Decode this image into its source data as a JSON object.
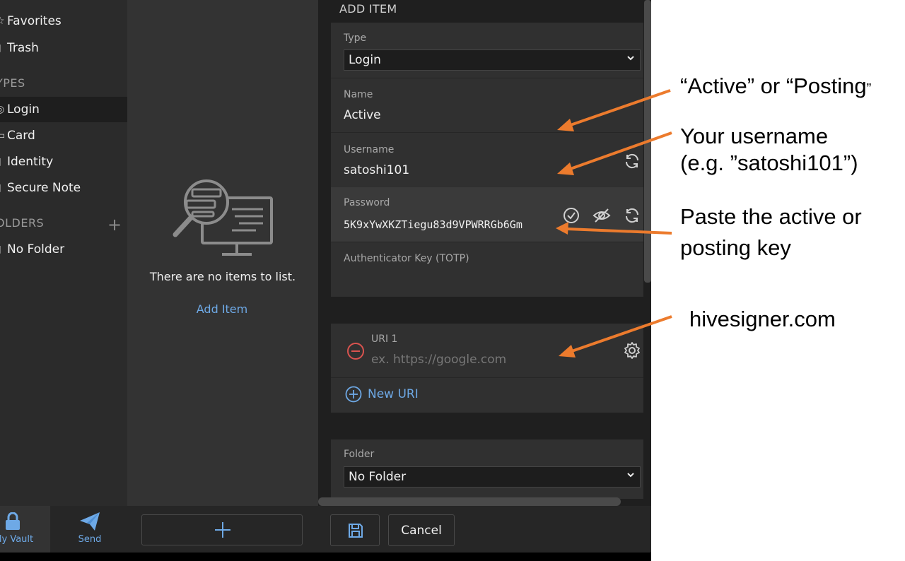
{
  "sidebar": {
    "items": [
      {
        "label": "Favorites"
      },
      {
        "label": "Trash"
      },
      {
        "label": "Login"
      },
      {
        "label": "Card"
      },
      {
        "label": "Identity"
      },
      {
        "label": "Secure Note"
      },
      {
        "label": "No Folder"
      }
    ],
    "types_header": "YPES",
    "folders_header": "OLDERS"
  },
  "list": {
    "empty_text": "There are no items to list.",
    "add_item_link": "Add Item"
  },
  "editor": {
    "title": "ADD ITEM",
    "type_label": "Type",
    "type_value": "Login",
    "name_label": "Name",
    "name_value": "Active",
    "username_label": "Username",
    "username_value": "satoshi101",
    "password_label": "Password",
    "password_value": "5K9xYwXKZTiegu83d9VPWRRGb6Gm",
    "totp_label": "Authenticator Key (TOTP)",
    "uri_label": "URI 1",
    "uri_placeholder": "ex. https://google.com",
    "new_uri_label": "New URI",
    "folder_label": "Folder",
    "folder_value": "No Folder"
  },
  "bottombar": {
    "vault_label": "ly Vault",
    "send_label": "Send",
    "cancel_label": "Cancel"
  },
  "annotations": {
    "name_note": "“Active” or “Posting",
    "name_note_end": "”",
    "username_note_1": "Your username",
    "username_note_2": "(e.g. ”satoshi101”)",
    "password_note_1": "Paste the active or",
    "password_note_2": "posting key",
    "uri_note": "hivesigner.com"
  },
  "colors": {
    "accent": "#6ea9e6",
    "arrow": "#ec7b2d",
    "remove": "#d9534f"
  }
}
